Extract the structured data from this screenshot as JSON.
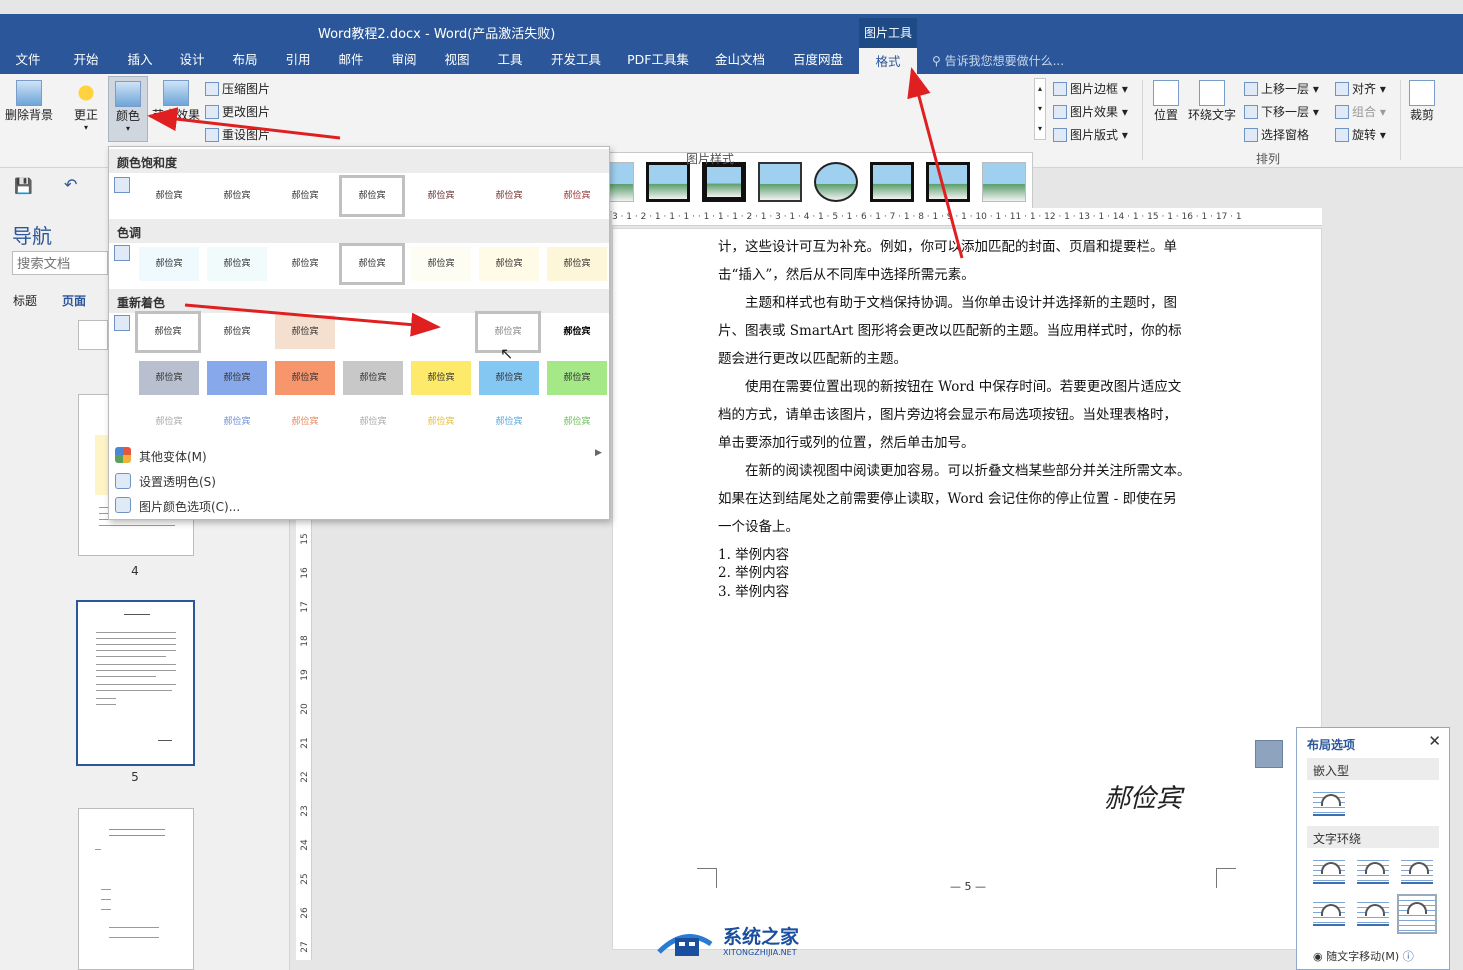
{
  "titlebar": {
    "title": "Word教程2.docx - Word(产品激活失败)",
    "context_tab": "图片工具"
  },
  "tabs": [
    "文件",
    "开始",
    "插入",
    "设计",
    "布局",
    "引用",
    "邮件",
    "审阅",
    "视图",
    "工具",
    "开发工具",
    "PDF工具集",
    "金山文档",
    "百度网盘",
    "格式"
  ],
  "tell_me": "告诉我您想要做什么...",
  "ribbon": {
    "remove_bg": "删除背景",
    "corrections": "更正",
    "color": "颜色",
    "artistic": "艺术效果",
    "compress": "压缩图片",
    "change": "更改图片",
    "reset": "重设图片",
    "styles_group": "图片样式",
    "border": "图片边框",
    "effects": "图片效果",
    "layout": "图片版式",
    "position": "位置",
    "wrap": "环绕文字",
    "forward": "上移一层",
    "backward": "下移一层",
    "selection_pane": "选择窗格",
    "align": "对齐",
    "group": "组合",
    "rotate": "旋转",
    "arrange_group": "排列",
    "crop": "裁剪"
  },
  "nav": {
    "title": "导航",
    "search_placeholder": "搜索文档",
    "tab_headings": "标题",
    "tab_pages": "页面",
    "page4": "4",
    "page5": "5"
  },
  "dropdown": {
    "saturation": "颜色饱和度",
    "tone": "色调",
    "recolor": "重新着色",
    "swatch_text": "郝俭宾",
    "more_variants": "其他变体(M)",
    "set_transparent": "设置透明色(S)",
    "color_options": "图片颜色选项(C)..."
  },
  "swatch_colors": {
    "tone": [
      "#eefafd",
      "#f1fbfb",
      "#ffffff",
      "#ffffff",
      "#fefdf3",
      "#fffbe6",
      "#fdf6d9"
    ],
    "recolor1": [
      "#ffffff",
      "#ffffff",
      "#f5dfcf",
      "#ffffff",
      "#ffffff",
      "#ffffff"
    ],
    "recolor2": [
      "#b8c0cf",
      "#87a9ec",
      "#f7966c",
      "#c8c8c8",
      "#fde96a",
      "#85c7f3",
      "#a5e888"
    ]
  },
  "ruler_text": "3 · 1 · 2 · 1 · 1 · 1 ·   · 1 · 1 · 1 · 2 · 1 · 3 · 1 · 4 · 1 · 5 · 1 · 6 · 1 · 7 · 1 · 8 · 1 · 9 · 1 · 10 · 1 · 11 · 1 · 12 · 1 · 13 · 1 · 14 · 1 · 15 · 1 · 16 · 1 · 17 · 1",
  "vruler": [
    "27",
    "26",
    "25",
    "24",
    "23",
    "22",
    "21",
    "20",
    "19",
    "18",
    "17",
    "16",
    "15"
  ],
  "document": {
    "lines": [
      "计，这些设计可互为补充。例如，你可以添加匹配的封面、页眉和提要栏。单",
      "击“插入”，然后从不同库中选择所需元素。",
      "　　主题和样式也有助于文档保持协调。当你单击设计并选择新的主题时，图",
      "片、图表或 SmartArt 图形将会更改以匹配新的主题。当应用样式时，你的标",
      "题会进行更改以匹配新的主题。",
      "　　使用在需要位置出现的新按钮在 Word 中保存时间。若要更改图片适应文",
      "档的方式，请单击该图片，图片旁边将会显示布局选项按钮。当处理表格时，",
      "单击要添加行或列的位置，然后单击加号。",
      "　　在新的阅读视图中阅读更加容易。可以折叠文档某些部分并关注所需文本。",
      "如果在达到结尾处之前需要停止读取，Word 会记住你的停止位置 - 即使在另",
      "一个设备上。"
    ],
    "list": [
      "1. 举例内容",
      "2. 举例内容",
      "3. 举例内容"
    ],
    "signature": "郝俭宾",
    "page_footer": "— 5 —"
  },
  "layout_options": {
    "title": "布局选项",
    "inline": "嵌入型",
    "wrap": "文字环绕",
    "move_with_text": "随文字移动(M)"
  },
  "watermark": {
    "cn": "系统之家",
    "en": "XITONGZHIJIA.NET"
  },
  "accent": "#2b579a"
}
